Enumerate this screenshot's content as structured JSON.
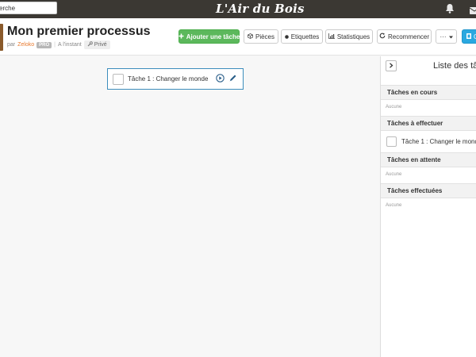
{
  "topbar": {
    "search_text": "erche",
    "logo": "L'Air du Bois"
  },
  "header": {
    "title": "Mon premier processus",
    "by_label": "par",
    "author": "Zeloko",
    "author_badge": "PRO",
    "separator": "|",
    "timestamp": "A l'instant",
    "visibility": "Privé"
  },
  "toolbar": {
    "add_task": "Ajouter une tâche",
    "parts": "Pièces",
    "tags": "Etiquettes",
    "stats": "Statistiques",
    "restart": "Recommencer",
    "more": "···",
    "cut_label": "C"
  },
  "canvas": {
    "task_card_label": "Tâche 1 : Changer le monde"
  },
  "sidebar": {
    "title": "Liste des tâ",
    "sections": [
      {
        "title": "Tâches en cours",
        "empty": "Aucune"
      },
      {
        "title": "Tâches à effectuer",
        "task": "Tâche 1 : Changer le monde"
      },
      {
        "title": "Tâches en attente",
        "empty": "Aucune"
      },
      {
        "title": "Tâches effectuées",
        "empty": "Aucune"
      }
    ]
  },
  "colors": {
    "topbar": "#3b3833",
    "accent_green": "#5cb85c",
    "accent_blue": "#2aa8e0",
    "author_orange": "#e8792e",
    "selection_border": "#3c8dbc"
  },
  "icons": [
    "bell-icon",
    "mail-icon",
    "plus-icon",
    "box-icon",
    "tag-icon",
    "chart-icon",
    "restart-icon",
    "caret-down-icon",
    "export-icon",
    "play-icon",
    "pencil-icon",
    "chevron-right-icon",
    "wrench-icon"
  ]
}
